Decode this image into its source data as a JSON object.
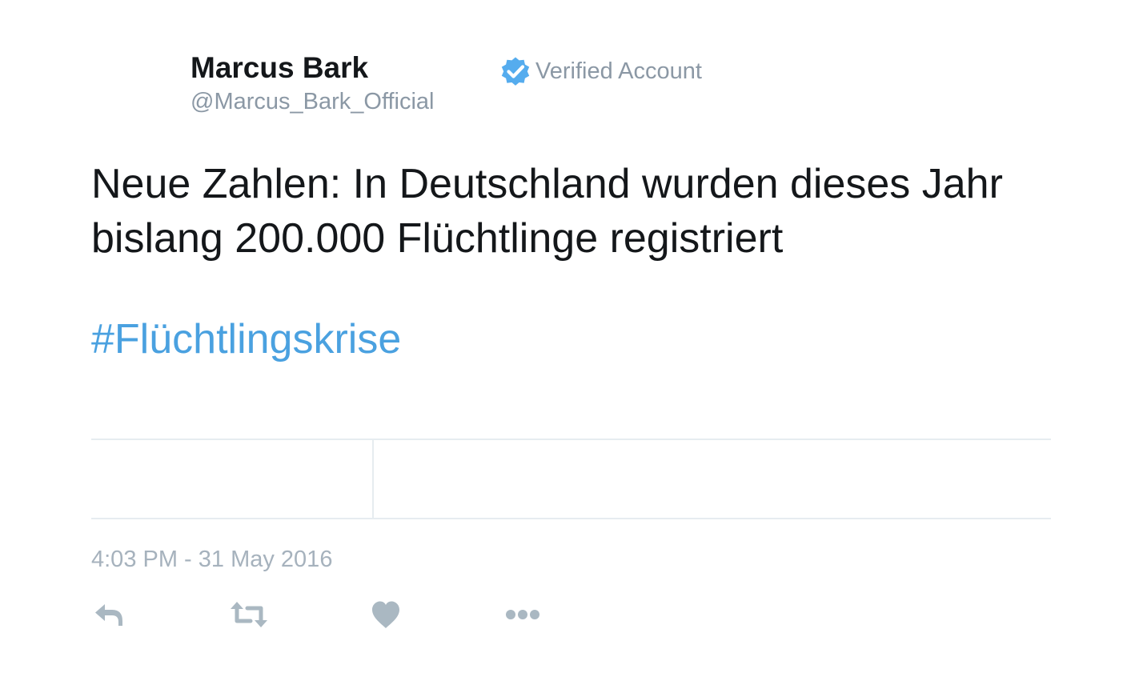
{
  "author": {
    "display_name": "Marcus Bark",
    "handle": "@Marcus_Bark_Official",
    "verified_label": "Verified Account"
  },
  "tweet": {
    "text": "Neue Zahlen: In Deutschland wurden dieses Jahr bislang 200.000 Flüchtlinge registriert",
    "hashtag": "#Flüchtlingskrise",
    "timestamp": "4:03 PM - 31 May 2016"
  },
  "actions": [
    {
      "icon": "reply-icon"
    },
    {
      "icon": "retweet-icon"
    },
    {
      "icon": "like-heart-icon"
    },
    {
      "icon": "more-dots-icon"
    }
  ],
  "colors": {
    "text": "#14171a",
    "muted": "#8b98a5",
    "hashtag": "#4aa1e0",
    "verified_badge": "#55acee",
    "icons": "#aab8c2",
    "divider": "#e6ecf0"
  }
}
